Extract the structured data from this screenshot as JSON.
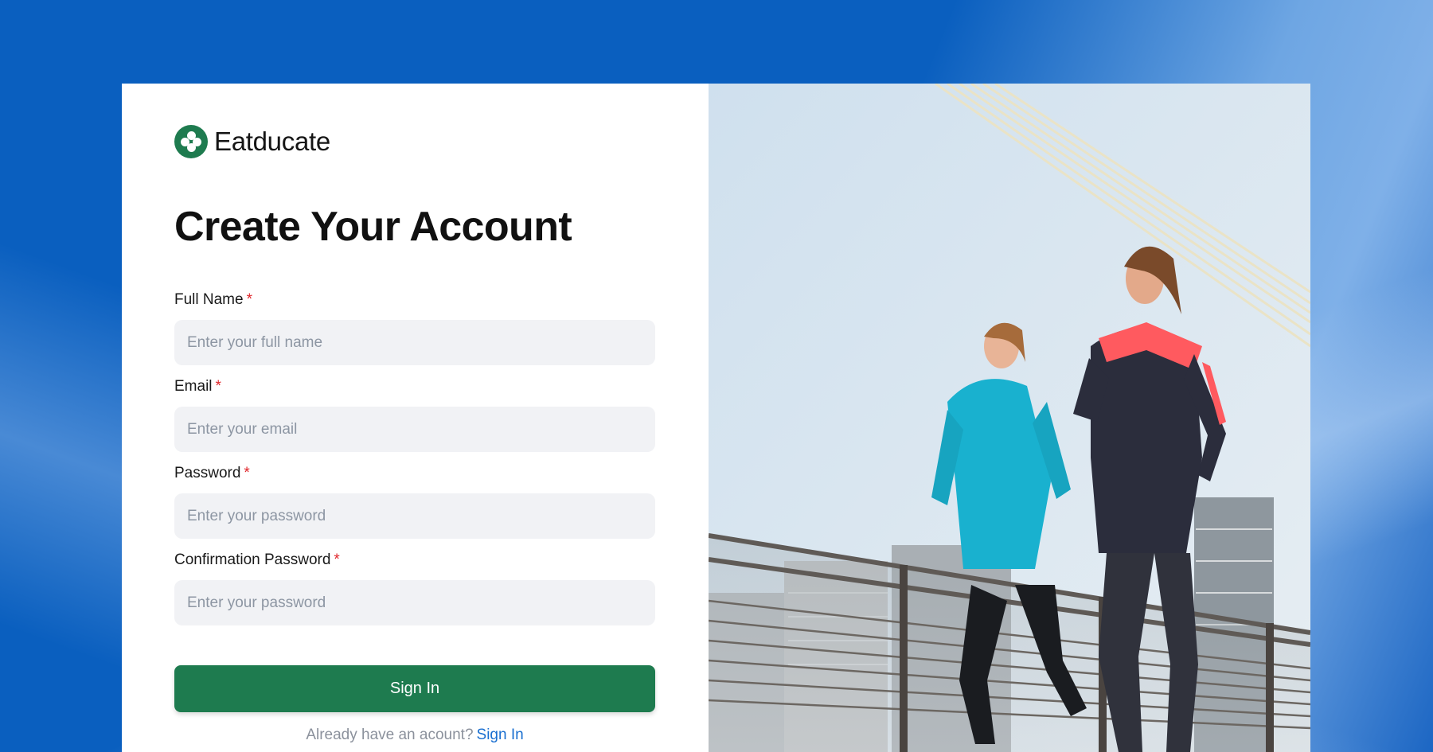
{
  "brand": {
    "name": "Eatducate"
  },
  "page": {
    "title": "Create Your Account"
  },
  "form": {
    "fields": [
      {
        "label": "Full Name",
        "required_mark": "*",
        "placeholder": "Enter your full name",
        "value": ""
      },
      {
        "label": "Email",
        "required_mark": "*",
        "placeholder": "Enter your email",
        "value": ""
      },
      {
        "label": "Password",
        "required_mark": "*",
        "placeholder": "Enter your password",
        "value": ""
      },
      {
        "label": "Confirmation Password",
        "required_mark": "*",
        "placeholder": "Enter your password",
        "value": ""
      }
    ],
    "submit_label": "Sign In",
    "footer_text": "Already have an acount?",
    "footer_link": "Sign In"
  },
  "colors": {
    "brand_green": "#1e7b4f",
    "background_blue": "#0a5fbf",
    "required_red": "#e0262b",
    "link_blue": "#1a6fd0",
    "input_bg": "#f1f2f5"
  },
  "icons": {
    "brand_logo": "four-petal-flower-icon"
  }
}
